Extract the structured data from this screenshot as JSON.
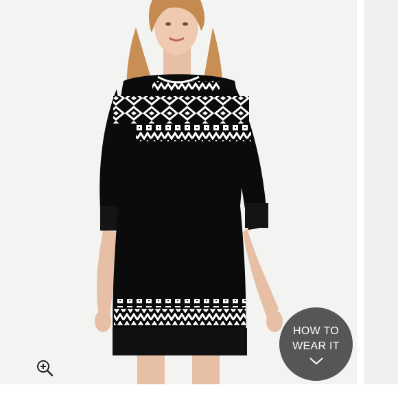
{
  "product_image": {
    "subject": "model-in-fair-isle-sweater-dress"
  },
  "controls": {
    "zoom_icon": "zoom-in-icon",
    "how_to_wear": {
      "line1": "HOW TO",
      "line2": "WEAR IT",
      "icon": "chevron-down-icon"
    }
  },
  "colors": {
    "background": "#f3f3f1",
    "dress": "#0b0b0b",
    "pattern": "#ffffff",
    "overlay_button": "#404040"
  }
}
